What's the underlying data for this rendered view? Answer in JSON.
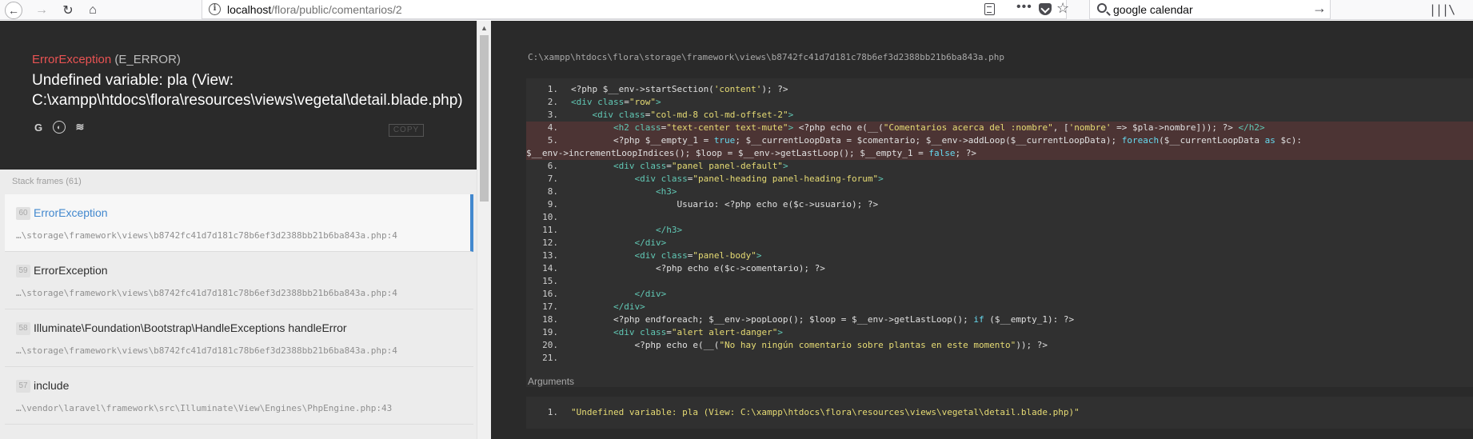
{
  "browser": {
    "url_host": "localhost",
    "url_path": "/flora/public/comentarios/2",
    "search_value": "google calendar"
  },
  "error": {
    "class": "ErrorException",
    "type": "(E_ERROR)",
    "message": "Undefined variable: pla (View: C:\\xampp\\htdocs\\flora\\resources\\views\\vegetal\\detail.blade.php)",
    "copy_label": "COPY"
  },
  "stack": {
    "label": "Stack frames (61)",
    "frames": [
      {
        "num": "60",
        "class": "ErrorException",
        "method": "",
        "file": "…\\storage\\framework\\views\\b8742fc41d7d181c78b6ef3d2388bb21b6ba843a.php:4"
      },
      {
        "num": "59",
        "class": "ErrorException",
        "method": "",
        "file": "…\\storage\\framework\\views\\b8742fc41d7d181c78b6ef3d2388bb21b6ba843a.php:4"
      },
      {
        "num": "58",
        "class": "Illuminate\\Foundation\\Bootstrap\\HandleExceptions",
        "method": "handleError",
        "file": "…\\storage\\framework\\views\\b8742fc41d7d181c78b6ef3d2388bb21b6ba843a.php:4"
      },
      {
        "num": "57",
        "class": "include",
        "method": "",
        "file": "…\\vendor\\laravel\\framework\\src\\Illuminate\\View\\Engines\\PhpEngine.php:43"
      }
    ]
  },
  "code": {
    "file_path": "C:\\xampp\\htdocs\\flora\\storage\\framework\\views\\b8742fc41d7d181c78b6ef3d2388bb21b6ba843a.php",
    "highlight_lines": [
      "4",
      "5"
    ],
    "lines": [
      {
        "n": "1.",
        "tokens": [
          [
            "",
            "<?php $__env->startSection("
          ],
          [
            "str",
            "'content'"
          ],
          [
            "",
            "); ?>"
          ]
        ]
      },
      {
        "n": "2.",
        "tokens": [
          [
            "tag",
            "<div "
          ],
          [
            "attr",
            "class"
          ],
          [
            "",
            "="
          ],
          [
            "str",
            "\"row\""
          ],
          [
            "tag",
            ">"
          ]
        ]
      },
      {
        "n": "3.",
        "tokens": [
          [
            "",
            "    "
          ],
          [
            "tag",
            "<div "
          ],
          [
            "attr",
            "class"
          ],
          [
            "",
            "="
          ],
          [
            "str",
            "\"col-md-8 col-md-offset-2\""
          ],
          [
            "tag",
            ">"
          ]
        ]
      },
      {
        "n": "4.",
        "tokens": [
          [
            "",
            "        "
          ],
          [
            "tag",
            "<h2 "
          ],
          [
            "attr",
            "class"
          ],
          [
            "",
            "="
          ],
          [
            "str",
            "\"text-center text-mute\""
          ],
          [
            "tag",
            ">"
          ],
          [
            "",
            " <?php echo e(__("
          ],
          [
            "str",
            "\"Comentarios acerca del :nombre\""
          ],
          [
            "",
            ", ["
          ],
          [
            "str",
            "'nombre'"
          ],
          [
            "",
            " => $pla->nombre])); ?> "
          ],
          [
            "tag",
            "</h2>"
          ]
        ]
      },
      {
        "n": "5.",
        "tokens": [
          [
            "",
            "        <?php $__empty_1 = "
          ],
          [
            "kw",
            "true"
          ],
          [
            "",
            "; $__currentLoopData = $comentario; $__env->addLoop($__currentLoopData); "
          ],
          [
            "kw",
            "foreach"
          ],
          [
            "",
            "($__currentLoopData "
          ],
          [
            "kw",
            "as"
          ],
          [
            "",
            " $c):"
          ]
        ]
      },
      {
        "n": "",
        "tokens": [
          [
            "",
            "$__env->incrementLoopIndices(); $loop = $__env->getLastLoop(); $__empty_1 = "
          ],
          [
            "kw",
            "false"
          ],
          [
            "",
            "; ?>"
          ]
        ]
      },
      {
        "n": "6.",
        "tokens": [
          [
            "",
            "        "
          ],
          [
            "tag",
            "<div "
          ],
          [
            "attr",
            "class"
          ],
          [
            "",
            "="
          ],
          [
            "str",
            "\"panel panel-default\""
          ],
          [
            "tag",
            ">"
          ]
        ]
      },
      {
        "n": "7.",
        "tokens": [
          [
            "",
            "            "
          ],
          [
            "tag",
            "<div "
          ],
          [
            "attr",
            "class"
          ],
          [
            "",
            "="
          ],
          [
            "str",
            "\"panel-heading panel-heading-forum\""
          ],
          [
            "tag",
            ">"
          ]
        ]
      },
      {
        "n": "8.",
        "tokens": [
          [
            "",
            "                "
          ],
          [
            "tag",
            "<h3>"
          ]
        ]
      },
      {
        "n": "9.",
        "tokens": [
          [
            "",
            "                    Usuario: <?php echo e($c->usuario); ?>"
          ]
        ]
      },
      {
        "n": "10.",
        "tokens": [
          [
            "",
            ""
          ]
        ]
      },
      {
        "n": "11.",
        "tokens": [
          [
            "",
            "                "
          ],
          [
            "tag",
            "</h3>"
          ]
        ]
      },
      {
        "n": "12.",
        "tokens": [
          [
            "",
            "            "
          ],
          [
            "tag",
            "</div>"
          ]
        ]
      },
      {
        "n": "13.",
        "tokens": [
          [
            "",
            "            "
          ],
          [
            "tag",
            "<div "
          ],
          [
            "attr",
            "class"
          ],
          [
            "",
            "="
          ],
          [
            "str",
            "\"panel-body\""
          ],
          [
            "tag",
            ">"
          ]
        ]
      },
      {
        "n": "14.",
        "tokens": [
          [
            "",
            "                <?php echo e($c->comentario); ?>"
          ]
        ]
      },
      {
        "n": "15.",
        "tokens": [
          [
            "",
            ""
          ]
        ]
      },
      {
        "n": "16.",
        "tokens": [
          [
            "",
            "            "
          ],
          [
            "tag",
            "</div>"
          ]
        ]
      },
      {
        "n": "17.",
        "tokens": [
          [
            "",
            "        "
          ],
          [
            "tag",
            "</div>"
          ]
        ]
      },
      {
        "n": "18.",
        "tokens": [
          [
            "",
            "        <?php endforeach; $__env->popLoop(); $loop = $__env->getLastLoop(); "
          ],
          [
            "kw",
            "if"
          ],
          [
            "",
            " ($__empty_1): ?>"
          ]
        ]
      },
      {
        "n": "19.",
        "tokens": [
          [
            "",
            "        "
          ],
          [
            "tag",
            "<div "
          ],
          [
            "attr",
            "class"
          ],
          [
            "",
            "="
          ],
          [
            "str",
            "\"alert alert-danger\""
          ],
          [
            "tag",
            ">"
          ]
        ]
      },
      {
        "n": "20.",
        "tokens": [
          [
            "",
            "            <?php echo e(__("
          ],
          [
            "str",
            "\"No hay ningún comentario sobre plantas en este momento\""
          ],
          [
            "",
            ")); ?>"
          ]
        ]
      },
      {
        "n": "21.",
        "tokens": [
          [
            "",
            ""
          ]
        ]
      }
    ]
  },
  "arguments": {
    "label": "Arguments",
    "items": [
      {
        "n": "1.",
        "value": "\"Undefined variable: pla (View: C:\\xampp\\htdocs\\flora\\resources\\views\\vegetal\\detail.blade.php)\""
      }
    ]
  },
  "colors": {
    "accent": "#4288ce",
    "error_red": "#e95353",
    "highlight_row": "#4c3434",
    "string": "#e6db74",
    "tag": "#61c7b4",
    "keyword": "#66d9ef"
  }
}
